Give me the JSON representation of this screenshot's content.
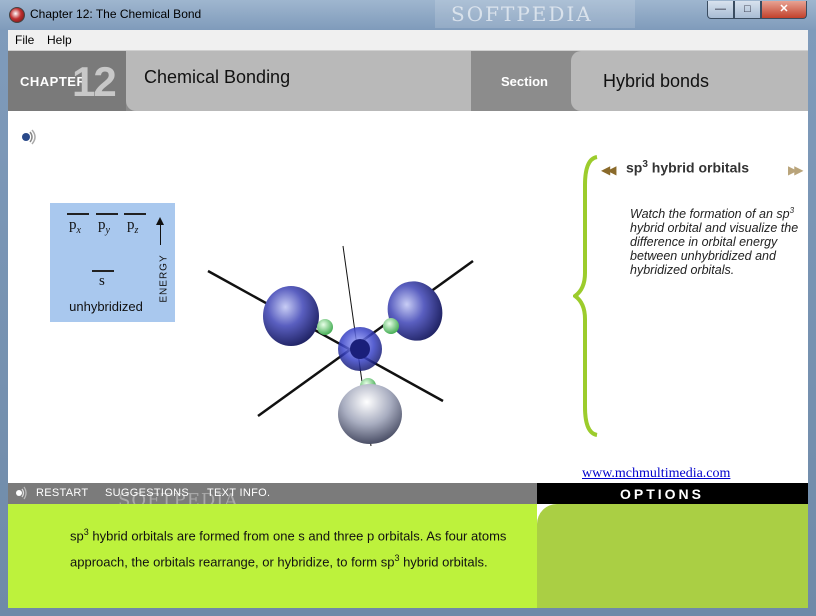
{
  "window": {
    "title": "Chapter 12: The Chemical Bond",
    "watermark": "SOFTPEDIA",
    "minimize_glyph": "—",
    "maximize_glyph": "□",
    "close_glyph": "✕"
  },
  "menu": {
    "file": "File",
    "help": "Help"
  },
  "header": {
    "chapter_label": "CHAPTER",
    "chapter_number": "12",
    "title": "Chemical Bonding",
    "section_label": "Section",
    "section_name": "Hybrid bonds"
  },
  "energy_diagram": {
    "p_orbitals": [
      {
        "letter": "p",
        "sub": "x"
      },
      {
        "letter": "p",
        "sub": "y"
      },
      {
        "letter": "p",
        "sub": "z"
      }
    ],
    "s_orbital": "s",
    "axis_label": "ENERGY",
    "caption": "unhybridized"
  },
  "panel": {
    "title_prefix": "sp",
    "title_sup": "3",
    "title_suffix": " hybrid orbitals",
    "prev_glyph": "◀◀",
    "next_glyph": "▶▶",
    "text_1": "Watch the formation of an sp",
    "text_sup": "3",
    "text_2": " hybrid orbital and visualize the difference in orbital energy between unhybridized and hybridized orbitals."
  },
  "link": {
    "url_text": "www.mchmultimedia.com"
  },
  "toolbar": {
    "restart": "RESTART",
    "suggestions": "SUGGESTIONS",
    "text_info": "TEXT INFO.",
    "watermark": "SOFTPEDIA"
  },
  "options": {
    "label": "OPTIONS"
  },
  "description": {
    "part1": "sp",
    "sup1": "3",
    "part2": " hybrid orbitals are formed from one s and three p orbitals. As four atoms approach, the orbitals rearrange, or hybridize, to form sp",
    "sup2": "3",
    "part3": "  hybrid orbitals."
  },
  "colors": {
    "header_dark": "#7a7a7a",
    "header_light": "#b9b9b9",
    "energy_box": "#a9c8ee",
    "lime": "#bdf23c",
    "brace": "#9ccc2c",
    "link": "#0000cc"
  }
}
